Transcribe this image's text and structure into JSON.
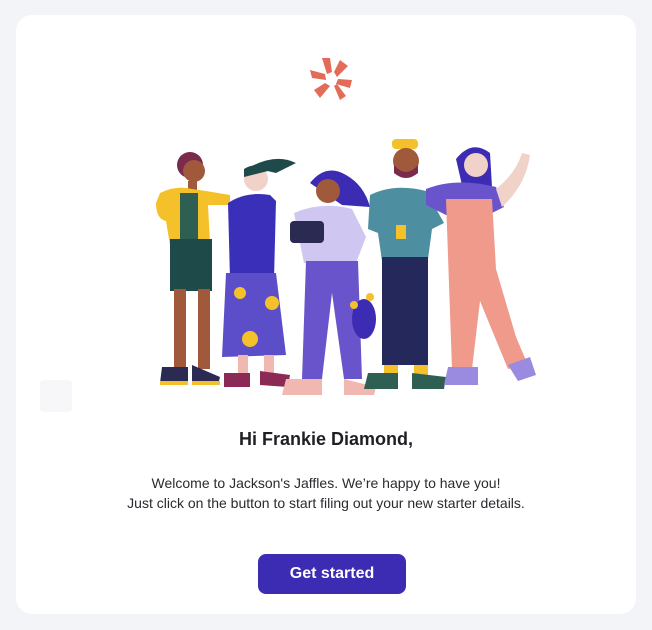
{
  "greeting": "Hi Frankie Diamond,",
  "message": {
    "line1": "Welcome to Jackson's Jaffles. We’re happy to have you!",
    "line2": "Just click on the button to start filing out your new starter details."
  },
  "cta": {
    "label": "Get started"
  },
  "colors": {
    "brand_accent": "#e36b5a",
    "button": "#3c2bb3",
    "page_bg": "#f3f4f7"
  },
  "icons": {
    "logo": "brand-logo",
    "illustration": "team-welcome-illustration"
  }
}
